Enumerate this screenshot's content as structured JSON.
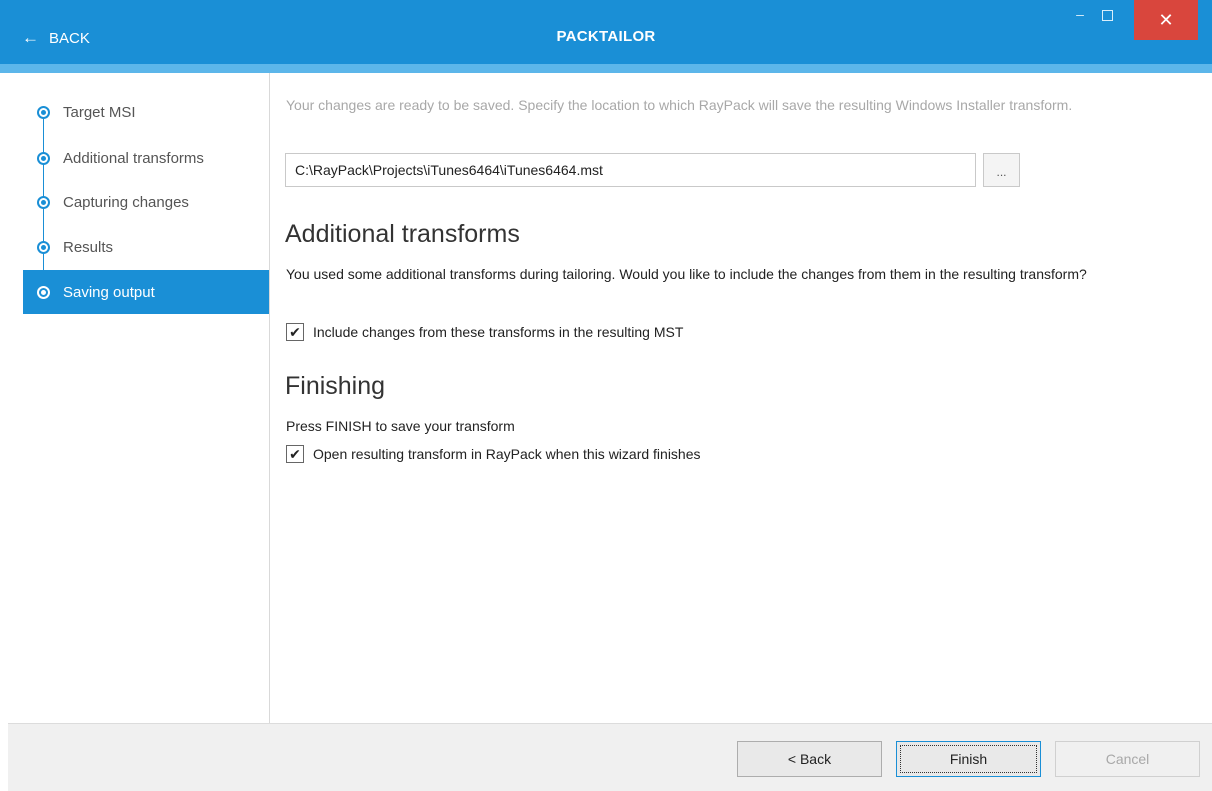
{
  "titlebar": {
    "back_label": "BACK",
    "title": "PACKTAILOR",
    "minimize_glyph": "–",
    "close_glyph": "✕"
  },
  "sidebar": {
    "steps": [
      {
        "label": "Target MSI"
      },
      {
        "label": "Additional transforms"
      },
      {
        "label": "Capturing changes"
      },
      {
        "label": "Results"
      },
      {
        "label": "Saving output",
        "active": true
      }
    ]
  },
  "main": {
    "intro": "Your changes are ready to be saved. Specify the location to which RayPack will save the resulting Windows Installer transform.",
    "path_value": "C:\\RayPack\\Projects\\iTunes6464\\iTunes6464.mst",
    "browse_label": "...",
    "additional": {
      "heading": "Additional transforms",
      "description": "You used some additional transforms during tailoring. Would you like to include the changes from them in the resulting transform?",
      "checkbox_label": "Include changes from these transforms in the resulting MST",
      "checked": true
    },
    "finishing": {
      "heading": "Finishing",
      "description": "Press FINISH to save your transform",
      "checkbox_label": "Open resulting transform in RayPack when this wizard finishes",
      "checked": true
    }
  },
  "footer": {
    "back_label": "< Back",
    "finish_label": "Finish",
    "cancel_label": "Cancel"
  },
  "colors": {
    "accent": "#1a8fd6",
    "close": "#d9463d"
  }
}
